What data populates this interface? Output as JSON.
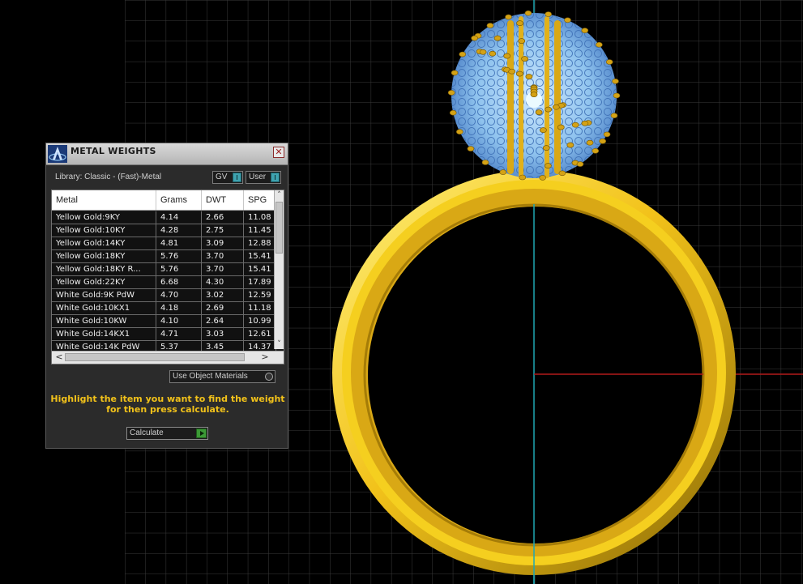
{
  "panel": {
    "title": "METAL WEIGHTS",
    "close_glyph": "✕",
    "library_label": "Library: Classic - (Fast)-Metal",
    "toggle_gv": "GV",
    "toggle_user": "User",
    "columns": [
      "Metal",
      "Grams",
      "DWT",
      "SPG"
    ],
    "rows": [
      [
        "Yellow Gold:9KY",
        "4.14",
        "2.66",
        "11.08"
      ],
      [
        "Yellow Gold:10KY",
        "4.28",
        "2.75",
        "11.45"
      ],
      [
        "Yellow Gold:14KY",
        "4.81",
        "3.09",
        "12.88"
      ],
      [
        "Yellow Gold:18KY",
        "5.76",
        "3.70",
        "15.41"
      ],
      [
        "Yellow Gold:18KY R...",
        "5.76",
        "3.70",
        "15.41"
      ],
      [
        "Yellow Gold:22KY",
        "6.68",
        "4.30",
        "17.89"
      ],
      [
        "White Gold:9K PdW",
        "4.70",
        "3.02",
        "12.59"
      ],
      [
        "White Gold:10KX1",
        "4.18",
        "2.69",
        "11.18"
      ],
      [
        "White Gold:10KW",
        "4.10",
        "2.64",
        "10.99"
      ],
      [
        "White Gold:14KX1",
        "4.71",
        "3.03",
        "12.61"
      ],
      [
        "White Gold:14K PdW",
        "5.37",
        "3.45",
        "14.37"
      ]
    ],
    "scroll": {
      "up": "˄",
      "down": "˅",
      "left": "<",
      "right": ">"
    },
    "use_object_materials": "Use Object Materials",
    "hint": "Highlight the item you want to find the weight for then press calculate.",
    "calculate_label": "Calculate"
  },
  "colors": {
    "viewport_bg": "#000000",
    "grid": "#3a3a3a",
    "axis_y": "#1fa7b3",
    "axis_x": "#b21a1a",
    "gold": "#f2c21a",
    "gem": "#8fc3ee",
    "hint_text": "#f2c21a",
    "accent_toggle": "#3fa3b0",
    "calc_button": "#3c9a36"
  },
  "icons": [
    "app-logo-icon",
    "close-icon",
    "toggle-indicator-icon",
    "radio-icon",
    "play-icon",
    "scroll-up-icon",
    "scroll-down-icon",
    "scroll-left-icon",
    "scroll-right-icon"
  ]
}
